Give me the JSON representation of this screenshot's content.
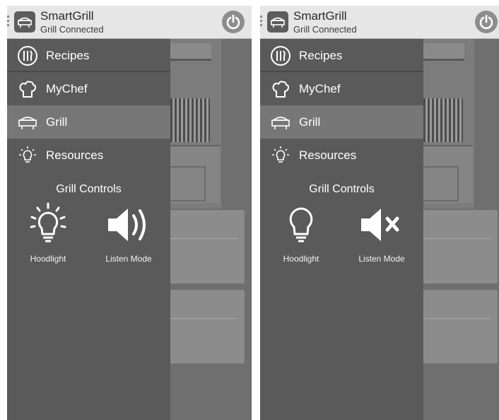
{
  "screens": [
    {
      "app": {
        "title": "SmartGrill",
        "subtitle": "Grill Connected"
      },
      "menu": [
        {
          "label": "Recipes",
          "icon": "utensils-icon"
        },
        {
          "label": "MyChef",
          "icon": "chef-hat-icon"
        },
        {
          "label": "Grill",
          "icon": "grill-icon",
          "selected": true
        },
        {
          "label": "Resources",
          "icon": "lightbulb-icon"
        }
      ],
      "controls_title": "Grill Controls",
      "controls": [
        {
          "label": "Hoodlight",
          "state": "on",
          "icon": "lightbulb-on-icon"
        },
        {
          "label": "Listen Mode",
          "state": "on",
          "icon": "speaker-on-icon"
        }
      ]
    },
    {
      "app": {
        "title": "SmartGrill",
        "subtitle": "Grill Connected"
      },
      "menu": [
        {
          "label": "Recipes",
          "icon": "utensils-icon"
        },
        {
          "label": "MyChef",
          "icon": "chef-hat-icon"
        },
        {
          "label": "Grill",
          "icon": "grill-icon",
          "selected": true
        },
        {
          "label": "Resources",
          "icon": "lightbulb-icon"
        }
      ],
      "controls_title": "Grill Controls",
      "controls": [
        {
          "label": "Hoodlight",
          "state": "off",
          "icon": "lightbulb-off-icon"
        },
        {
          "label": "Listen Mode",
          "state": "off",
          "icon": "speaker-muted-icon"
        }
      ]
    }
  ],
  "colors": {
    "drawer": "#5a5a5a",
    "selected_item": "#777777",
    "topbar": "#e6e6e6",
    "power_button": "#8d8d8d"
  }
}
